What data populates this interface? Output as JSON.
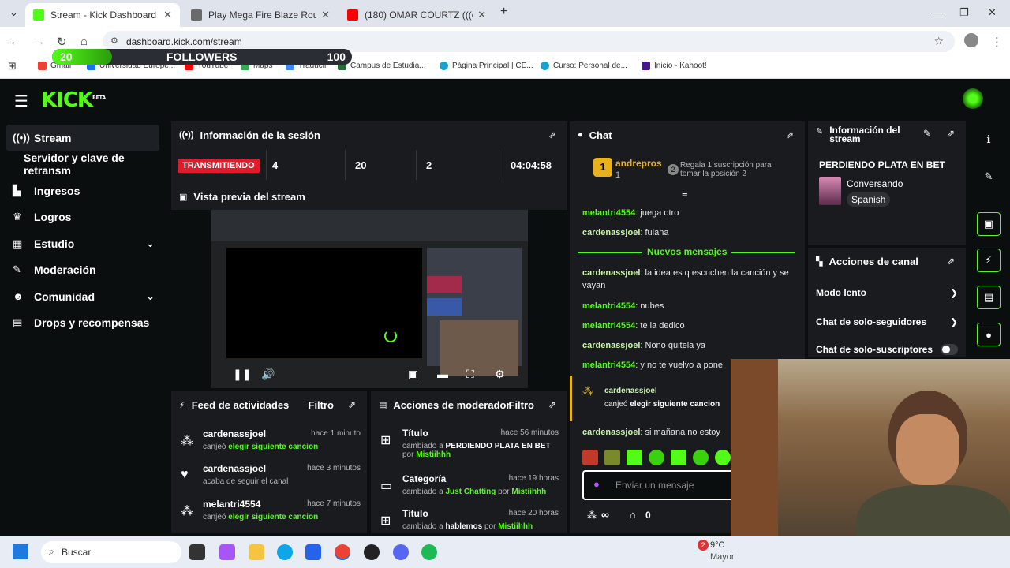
{
  "browser": {
    "tabs": [
      {
        "title": "Stream - Kick Dashboard",
        "color": "#53fc18"
      },
      {
        "title": "Play Mega Fire Blaze Roulette",
        "color": "#6a6a6a"
      },
      {
        "title": "(180) OMAR COURTZ (((ousi)))",
        "color": "#ff0000"
      }
    ],
    "url": "dashboard.kick.com/stream",
    "bookmarks": [
      "Gmail",
      "Universidad Europe...",
      "YouTube",
      "Maps",
      "Traducir",
      "Campus de Estudia...",
      "Página Principal | CE...",
      "Curso: Personal de...",
      "Inicio - Kahoot!"
    ]
  },
  "followers_goal": {
    "current": "20",
    "label": "FOLLOWERS",
    "target": "100",
    "progress": 0.2
  },
  "app": {
    "logo": "KICK",
    "logo_tag": "BETA",
    "sidebar": [
      {
        "label": "Stream",
        "icon": "broadcast-icon"
      },
      {
        "label": "Servidor y clave de retransm",
        "icon": ""
      },
      {
        "label": "Ingresos",
        "icon": "chart-icon"
      },
      {
        "label": "Logros",
        "icon": "trophy-icon"
      },
      {
        "label": "Estudio",
        "icon": "grid-icon"
      },
      {
        "label": "Moderación",
        "icon": "wrench-icon"
      },
      {
        "label": "Comunidad",
        "icon": "people-icon"
      },
      {
        "label": "Drops y recompensas",
        "icon": "gift-icon"
      }
    ],
    "session": {
      "title": "Información de la sesión",
      "status": "TRANSMITIENDO",
      "viewers": "4",
      "followers": "20",
      "subs": "2",
      "duration": "04:04:58"
    },
    "preview_title": "Vista previa del stream",
    "activity": {
      "title": "Feed de actividades",
      "filter": "Filtro",
      "items": [
        {
          "user": "cardenassjoel",
          "time": "hace 1 minuto",
          "text": "canjeó",
          "highlight": "elegir siguiente cancion"
        },
        {
          "user": "cardenassjoel",
          "time": "hace 3 minutos",
          "text": "acaba de seguir el canal",
          "highlight": ""
        },
        {
          "user": "melantri4554",
          "time": "hace 7 minutos",
          "text": "canjeó",
          "highlight": "elegir siguiente cancion"
        }
      ]
    },
    "modactions": {
      "title": "Acciones de moderador",
      "filter": "Filtro",
      "items": [
        {
          "action": "Título",
          "time": "hace 56 minutos",
          "text": "cambiado a",
          "value": "PERDIENDO PLATA EN BET",
          "by": "por",
          "mod": "Mistiihhh"
        },
        {
          "action": "Categoría",
          "time": "hace 19 horas",
          "text": "cambiado a",
          "value": "Just Chatting",
          "by": "por",
          "mod": "Mistiihhh"
        },
        {
          "action": "Título",
          "time": "hace 20 horas",
          "text": "cambiado a",
          "value": "hablemos",
          "by": "por",
          "mod": "Mistiihhh"
        }
      ]
    },
    "chat": {
      "title": "Chat",
      "top_user": "andrepros",
      "top_rank": "1",
      "top_count": "1",
      "gift_rank": "2",
      "gift_text": "Regala 1 suscripción para tomar la posición 2",
      "new_messages": "Nuevos mensajes",
      "messages": [
        {
          "user": "melantri4554",
          "text": "juega otro"
        },
        {
          "user": "cardenassjoel",
          "text": "fulana"
        },
        {
          "user": "cardenassjoel",
          "text": "la idea es q escuchen la canción y se vayan"
        },
        {
          "user": "melantri4554",
          "text": "nubes"
        },
        {
          "user": "melantri4554",
          "text": "te la dedico"
        },
        {
          "user": "cardenassjoel",
          "text": "Nono quitela ya"
        },
        {
          "user": "melantri4554",
          "text": "y no te vuelvo a pone"
        }
      ],
      "redeem_user": "cardenassjoel",
      "redeem_text": "canjeó",
      "redeem_item": "elegir siguiente cancion",
      "last_user": "cardenassjoel",
      "last_text": "si mañana no estoy",
      "input_placeholder": "Enviar un mensaje",
      "points": "∞",
      "store_count": "0"
    },
    "stream_info": {
      "title": "Información del stream",
      "stream_title": "PERDIENDO PLATA EN BET",
      "category": "Conversando",
      "language": "Spanish"
    },
    "channel_actions": {
      "title": "Acciones de canal",
      "items": [
        "Modo lento",
        "Chat de solo-seguidores",
        "Chat de solo-suscriptores"
      ]
    }
  },
  "taskbar": {
    "search": "Buscar",
    "weather_temp": "9°C",
    "weather_desc": "Mayor",
    "notif": "2"
  }
}
